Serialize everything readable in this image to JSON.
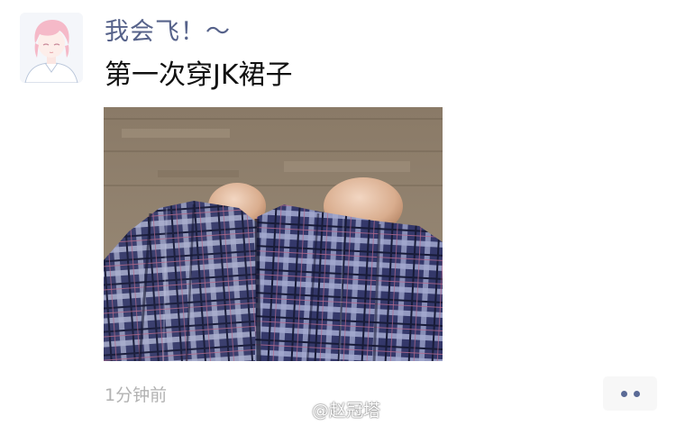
{
  "post": {
    "user_name": "我会飞！～",
    "text": "第一次穿JK裙子",
    "timestamp": "1分钟前",
    "avatar_icon": "anime-avatar",
    "photo": "plaid-skirt-photo"
  },
  "more_menu": {
    "icon": "more-dots-icon"
  },
  "watermark": {
    "text": "@赵冠塔",
    "icon": "weibo-icon"
  },
  "colors": {
    "name": "#56628a",
    "text": "#111111",
    "timestamp": "#b2b2b2",
    "more_button_bg": "#f7f7f7",
    "more_dots": "#5a6a96"
  }
}
